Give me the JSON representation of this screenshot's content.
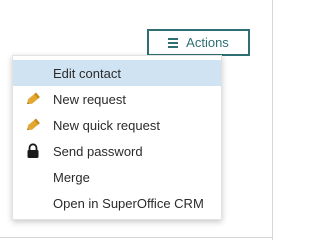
{
  "actions_button": {
    "label": "Actions",
    "icon": "hamburger-icon"
  },
  "menu": {
    "items": [
      {
        "label": "Edit contact",
        "icon": null,
        "highlighted": true
      },
      {
        "label": "New request",
        "icon": "pencil-icon"
      },
      {
        "label": "New quick request",
        "icon": "pencil-icon"
      },
      {
        "label": "Send password",
        "icon": "lock-icon"
      },
      {
        "label": "Merge",
        "icon": null
      },
      {
        "label": "Open in SuperOffice CRM",
        "icon": null
      }
    ]
  },
  "colors": {
    "accent": "#2f6f73",
    "highlight": "#cfe3f2",
    "pencil": "#e3a72f",
    "text": "#2b2b2b"
  }
}
